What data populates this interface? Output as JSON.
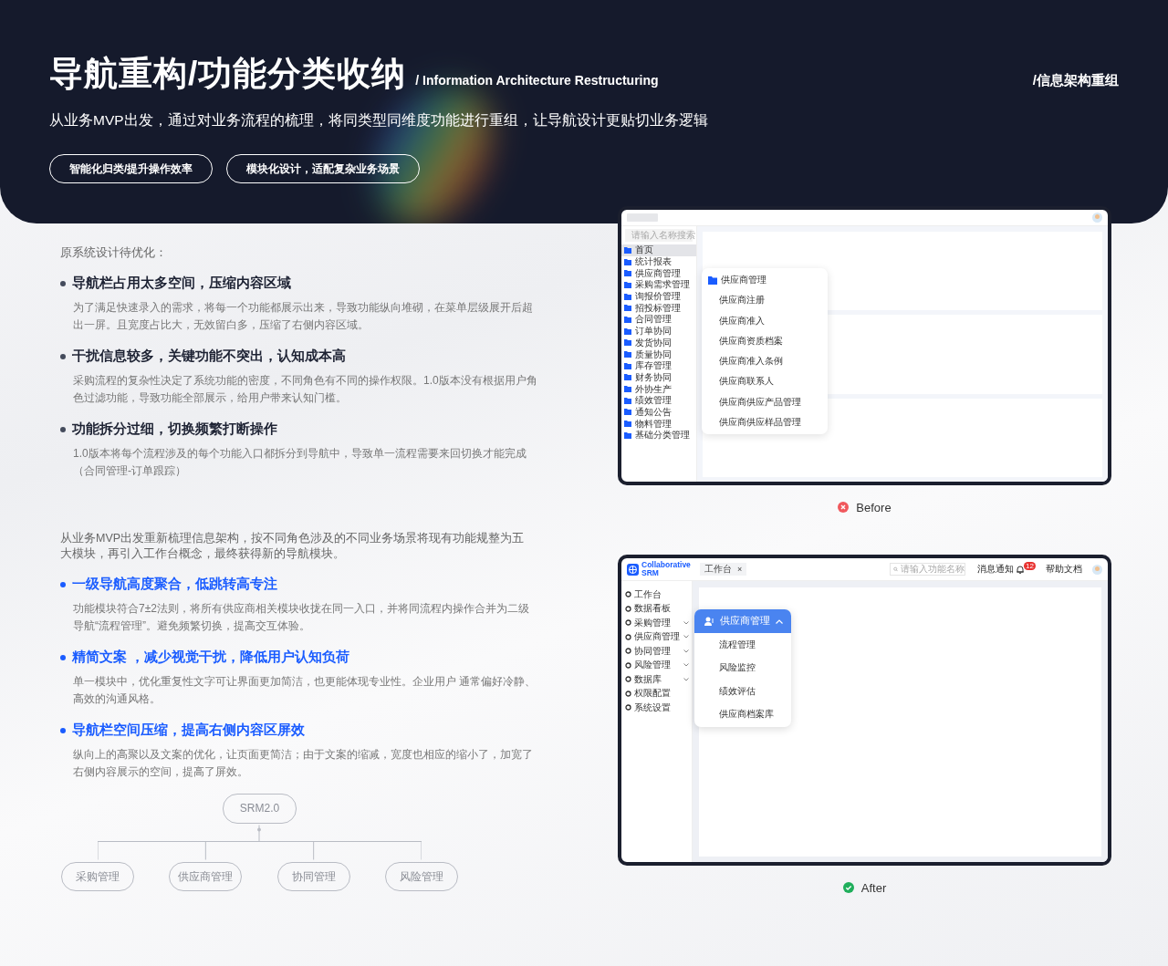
{
  "header": {
    "title": "导航重构/功能分类收纳",
    "subtitle": "/ Information Architecture Restructuring",
    "section_tag": "/信息架构重组",
    "description": "从业务MVP出发，通过对业务流程的梳理，将同类型同维度功能进行重组，让导航设计更贴切业务逻辑",
    "tags": [
      "智能化归类/提升操作效率",
      "模块化设计，适配复杂业务场景"
    ]
  },
  "problems": {
    "intro": "原系统设计待优化：",
    "items": [
      {
        "heading": "导航栏占用太多空间，压缩内容区域",
        "body": "为了满足快速录入的需求，将每一个功能都展示出来，导致功能纵向堆砌，在菜单层级展开后超出一屏。且宽度占比大，无效留白多，压缩了右侧内容区域。"
      },
      {
        "heading": "干扰信息较多，关键功能不突出，认知成本高",
        "body": "采购流程的复杂性决定了系统功能的密度，不同角色有不同的操作权限。1.0版本没有根据用户角色过滤功能，导致功能全部展示，给用户带来认知门槛。"
      },
      {
        "heading": "功能拆分过细，切换频繁打断操作",
        "body": "1.0版本将每个流程涉及的每个功能入口都拆分到导航中，导致单一流程需要来回切换才能完成（合同管理-订单跟踪）"
      }
    ]
  },
  "solutions": {
    "intro": "从业务MVP出发重新梳理信息架构，按不同角色涉及的不同业务场景将现有功能规整为五大模块，再引入工作台概念，最终获得新的导航模块。",
    "items": [
      {
        "heading": "一级导航高度聚合，低跳转高专注",
        "body": "功能模块符合7±2法则，将所有供应商相关模块收拢在同一入口，并将同流程内操作合并为二级导航“流程管理”。避免频繁切换，提高交互体验。"
      },
      {
        "heading": "精简文案 ，减少视觉干扰，降低用户认知负荷",
        "body": "单一模块中，优化重复性文字可让界面更加简洁，也更能体现专业性。企业用户 通常偏好冷静、高效的沟通风格。"
      },
      {
        "heading": "导航栏空间压缩，提高右侧内容区屏效",
        "body": "纵向上的高聚以及文案的优化，让页面更简洁；由于文案的缩减，宽度也相应的缩小了，加宽了右侧内容展示的空间，提高了屏效。"
      }
    ]
  },
  "diagram": {
    "root": "SRM2.0",
    "children": [
      "采购管理",
      "供应商管理",
      "协同管理",
      "风险管理"
    ]
  },
  "before": {
    "search_placeholder": "请输入名称搜索",
    "nav": [
      {
        "label": "首页",
        "selected": true
      },
      {
        "label": "统计报表",
        "selected": false
      },
      {
        "label": "供应商管理",
        "selected": false
      },
      {
        "label": "采购需求管理",
        "selected": false
      },
      {
        "label": "询报价管理",
        "selected": false
      },
      {
        "label": "招投标管理",
        "selected": false
      },
      {
        "label": "合同管理",
        "selected": false
      },
      {
        "label": "订单协同",
        "selected": false
      },
      {
        "label": "发货协同",
        "selected": false
      },
      {
        "label": "质量协同",
        "selected": false
      },
      {
        "label": "库存管理",
        "selected": false
      },
      {
        "label": "财务协同",
        "selected": false
      },
      {
        "label": "外协生产",
        "selected": false
      },
      {
        "label": "绩效管理",
        "selected": false
      },
      {
        "label": "通知公告",
        "selected": false
      },
      {
        "label": "物料管理",
        "selected": false
      },
      {
        "label": "基础分类管理",
        "selected": false
      }
    ],
    "flyout": [
      {
        "label": "供应商管理",
        "kind": "header"
      },
      {
        "label": "供应商注册",
        "kind": "item"
      },
      {
        "label": "供应商准入",
        "kind": "item"
      },
      {
        "label": "供应商资质档案",
        "kind": "item"
      },
      {
        "label": "供应商准入条例",
        "kind": "item"
      },
      {
        "label": "供应商联系人",
        "kind": "item"
      },
      {
        "label": "供应商供应产品管理",
        "kind": "item"
      },
      {
        "label": "供应商供应样品管理",
        "kind": "item"
      }
    ],
    "caption": {
      "label": "Before",
      "kind": "bad"
    }
  },
  "after": {
    "logo": "Collaborative SRM",
    "tab": {
      "label": "工作台",
      "close": "×"
    },
    "search_placeholder": "请输入功能名称",
    "notifications": {
      "label": "消息通知",
      "badge": "12"
    },
    "help": "帮助文档",
    "nav": [
      {
        "label": "工作台",
        "expandable": false
      },
      {
        "label": "数据看板",
        "expandable": false
      },
      {
        "label": "采购管理",
        "expandable": true
      },
      {
        "label": "供应商管理",
        "expandable": true
      },
      {
        "label": "协同管理",
        "expandable": true
      },
      {
        "label": "风险管理",
        "expandable": true
      },
      {
        "label": "数据库",
        "expandable": true
      },
      {
        "label": "权限配置",
        "expandable": false
      },
      {
        "label": "系统设置",
        "expandable": false
      }
    ],
    "flyout": {
      "label": "供应商管理",
      "expanded": true,
      "items": [
        "流程管理",
        "风险监控",
        "绩效评估",
        "供应商档案库"
      ]
    },
    "caption": {
      "label": "After",
      "kind": "good"
    }
  }
}
